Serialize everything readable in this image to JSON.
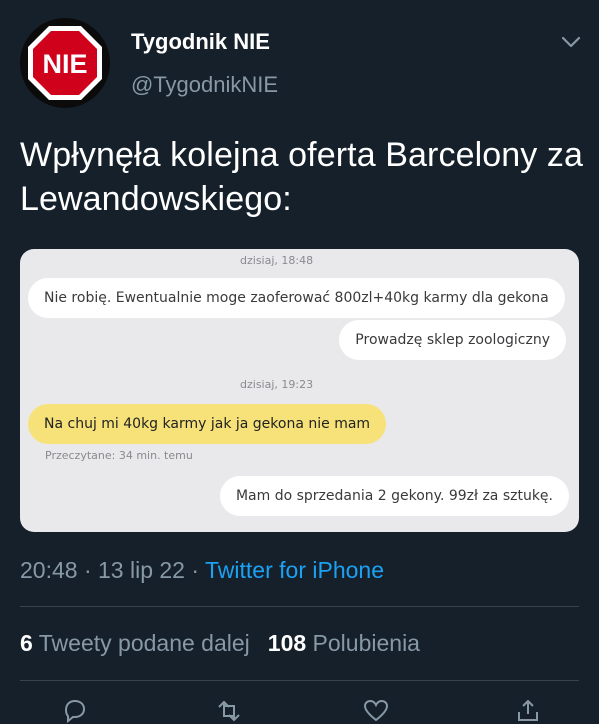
{
  "header": {
    "display_name": "Tygodnik NIE",
    "handle": "@TygodnikNIE",
    "avatar_text": "NIE",
    "menu_icon": "chevron-down-icon"
  },
  "tweet": {
    "text": "Wpłynęła kolejna oferta Barcelony za Lewandowskiego:"
  },
  "screenshot": {
    "timestamp1": "dzisiaj, 18:48",
    "msg1": "Nie robię. Ewentualnie moge zaoferować 800zl+40kg karmy dla gekona",
    "msg2": "Prowadzę sklep zoologiczny",
    "timestamp2": "dzisiaj, 19:23",
    "msg3": "Na chuj mi 40kg karmy jak ja gekona nie mam",
    "read_receipt": "Przeczytane: 34 min. temu",
    "msg4": "Mam do sprzedania 2 gekony. 99zł za sztukę."
  },
  "meta": {
    "time": "20:48",
    "sep1": " · ",
    "date": "13 lip 22",
    "sep2": " · ",
    "source": "Twitter for iPhone"
  },
  "stats": {
    "retweets_count": "6",
    "retweets_label": "Tweety podane dalej",
    "likes_count": "108",
    "likes_label": "Polubienia"
  },
  "colors": {
    "background": "#15202b",
    "secondary_text": "#8899a6",
    "link": "#1da1f2",
    "avatar_sign": "#d0021b"
  }
}
